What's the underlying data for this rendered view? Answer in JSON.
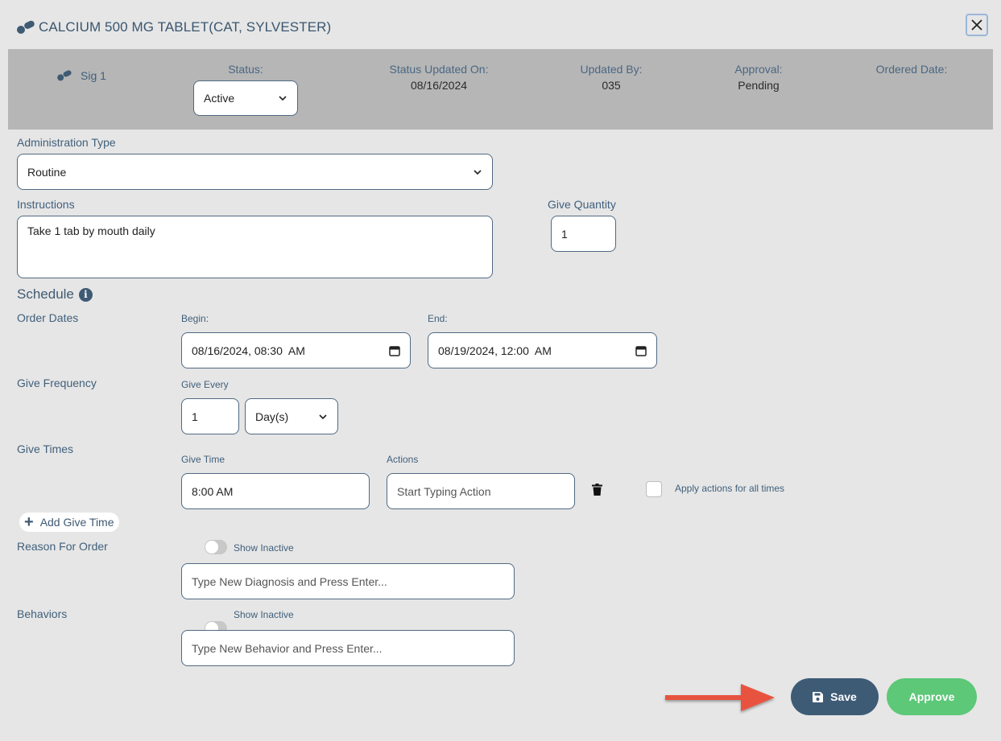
{
  "header": {
    "title": "CALCIUM 500 MG TABLET(CAT, SYLVESTER)",
    "close_icon": "close-icon"
  },
  "status_band": {
    "sig_label": "Sig 1",
    "status_label": "Status:",
    "status_value": "Active",
    "status_updated_label": "Status Updated On:",
    "status_updated_value": "08/16/2024",
    "updated_by_label": "Updated By:",
    "updated_by_value": "035",
    "approval_label": "Approval:",
    "approval_value": "Pending",
    "ordered_date_label": "Ordered Date:",
    "ordered_date_value": ""
  },
  "administration": {
    "label": "Administration Type",
    "value": "Routine"
  },
  "instructions": {
    "label": "Instructions",
    "value": "Take 1 tab by mouth daily"
  },
  "give_quantity": {
    "label": "Give Quantity",
    "value": "1"
  },
  "schedule": {
    "title": "Schedule",
    "info_glyph": "i",
    "order_dates_label": "Order Dates",
    "begin_label": "Begin:",
    "begin_value": "08/16/2024, 08:30  AM",
    "end_label": "End:",
    "end_value": "08/19/2024, 12:00  AM",
    "give_frequency_label": "Give Frequency",
    "give_every_label": "Give Every",
    "give_every_value": "1",
    "give_every_unit": "Day(s)",
    "give_times_label": "Give Times",
    "give_time_label": "Give Time",
    "give_time_value": "8:00 AM",
    "actions_label": "Actions",
    "actions_placeholder": "Start Typing Action",
    "apply_all_label": "Apply actions for all times",
    "add_give_time_label": "Add Give Time"
  },
  "reason": {
    "label": "Reason For Order",
    "show_inactive_label": "Show Inactive",
    "placeholder": "Type New Diagnosis and Press Enter..."
  },
  "behaviors": {
    "label": "Behaviors",
    "show_inactive_label": "Show Inactive",
    "placeholder": "Type New Behavior and Press Enter..."
  },
  "footer": {
    "save_label": "Save",
    "approve_label": "Approve"
  },
  "colors": {
    "background": "#e6e6e6",
    "band": "#b6b6b6",
    "primary": "#3e5b76",
    "approve": "#5cc878",
    "arrow": "#e8533f"
  }
}
